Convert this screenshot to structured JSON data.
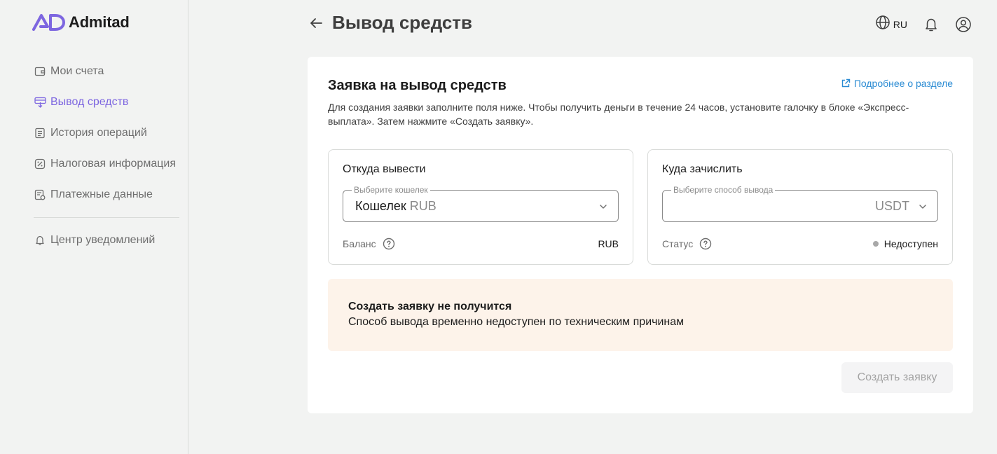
{
  "app": {
    "logo_text": "Admitad",
    "accent_color": "#7d66e0",
    "link_color": "#2a8bd3"
  },
  "sidebar": {
    "items": [
      {
        "label": "Мои счета",
        "icon": "wallet-icon",
        "active": false
      },
      {
        "label": "Вывод средств",
        "icon": "withdraw-icon",
        "active": true
      },
      {
        "label": "История операций",
        "icon": "history-icon",
        "active": false
      },
      {
        "label": "Налоговая информация",
        "icon": "percent-icon",
        "active": false
      },
      {
        "label": "Платежные данные",
        "icon": "payment-data-icon",
        "active": false
      }
    ],
    "bottom_items": [
      {
        "label": "Центр уведомлений",
        "icon": "bell-icon",
        "active": false
      }
    ]
  },
  "header": {
    "title": "Вывод средств",
    "language": "RU"
  },
  "card": {
    "title": "Заявка на вывод средств",
    "more_link": "Подробнее о разделе",
    "description": "Для создания заявки заполните поля ниже. Чтобы получить деньги в течение 24 часов, установите галочку в блоке «Экспресс-выплата». Затем нажмите «Создать заявку».",
    "from_panel": {
      "title": "Откуда вывести",
      "field_label": "Выберите кошелек",
      "field_value": "Кошелек",
      "field_value_currency": "RUB",
      "meta_label": "Баланс",
      "meta_value": "RUB"
    },
    "to_panel": {
      "title": "Куда зачислить",
      "field_label": "Выберите способ вывода",
      "field_value": "USDT",
      "meta_label": "Статус",
      "meta_value": "Недоступен",
      "status_color": "#a8a8a8"
    },
    "alert": {
      "title": "Создать заявку не получится",
      "text": "Способ вывода временно недоступен по техническим причинам",
      "background": "#fdf3ea"
    },
    "submit_label": "Создать заявку",
    "submit_disabled": true
  }
}
